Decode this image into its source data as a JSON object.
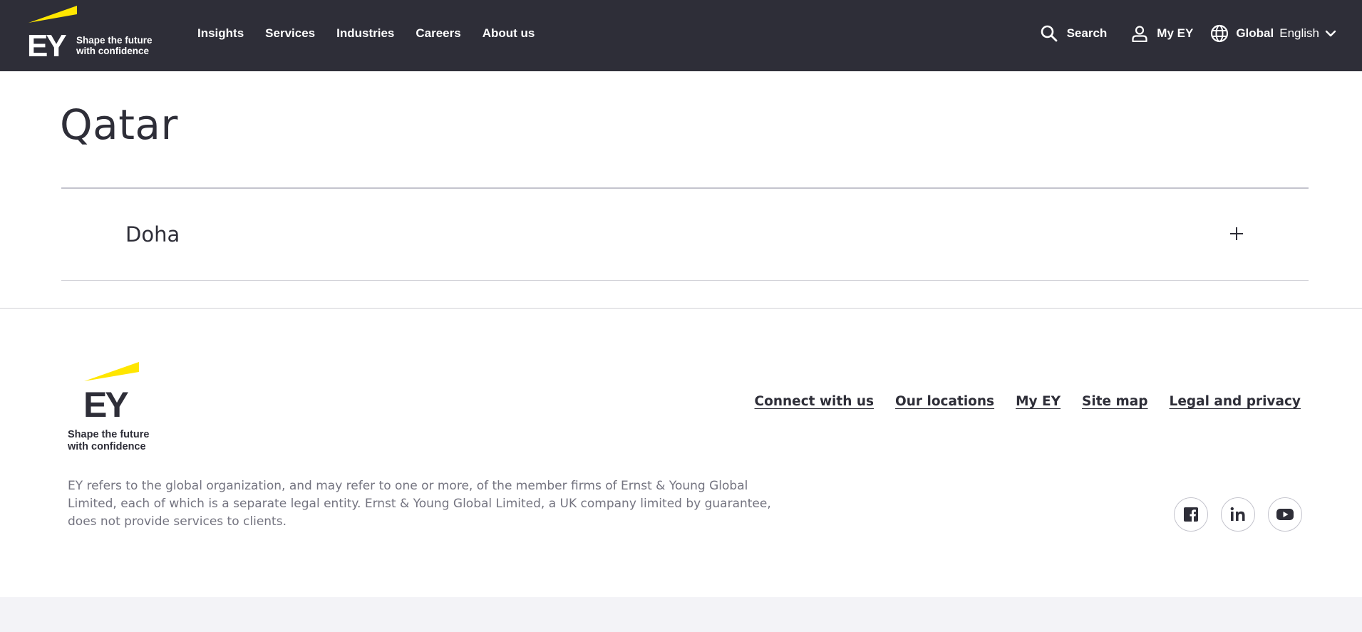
{
  "header": {
    "logo_text": "EY",
    "logo_tagline_1": "Shape the future",
    "logo_tagline_2": "with confidence",
    "nav": [
      {
        "label": "Insights"
      },
      {
        "label": "Services"
      },
      {
        "label": "Industries"
      },
      {
        "label": "Careers"
      },
      {
        "label": "About us"
      }
    ],
    "search_label": "Search",
    "myey_label": "My EY",
    "region_label": "Global",
    "language_label": "English"
  },
  "main": {
    "title": "Qatar",
    "accordion": [
      {
        "label": "Doha",
        "icon": "plus-icon"
      }
    ]
  },
  "footer": {
    "logo_text": "EY",
    "logo_tagline_1": "Shape the future",
    "logo_tagline_2": "with confidence",
    "links": [
      {
        "label": "Connect with us"
      },
      {
        "label": "Our locations"
      },
      {
        "label": "My EY"
      },
      {
        "label": "Site map"
      },
      {
        "label": "Legal and privacy"
      }
    ],
    "disclaimer": "EY refers to the global organization, and may refer to one or more, of the member firms of Ernst & Young Global Limited, each of which is a separate legal entity. Ernst & Young Global Limited, a UK company limited by guarantee, does not provide services to clients.",
    "social": [
      {
        "icon": "facebook-icon"
      },
      {
        "icon": "linkedin-icon"
      },
      {
        "icon": "youtube-icon"
      }
    ]
  },
  "colors": {
    "header_bg": "#2e2e38",
    "brand_yellow": "#ffe600",
    "text_dark": "#2e2e38",
    "text_muted": "#747480",
    "bottom_band": "#f3f3f7"
  }
}
